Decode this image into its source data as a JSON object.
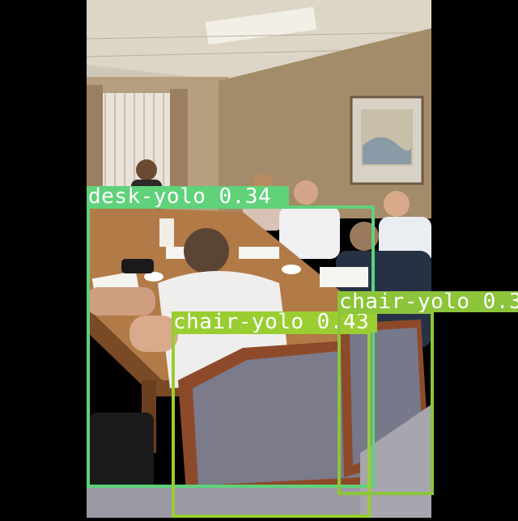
{
  "image": {
    "letterbox_color": "#000000",
    "scene": "conference room meeting around a wooden table"
  },
  "detections": [
    {
      "label": "desk-yolo 0.34",
      "class": "desk-yolo",
      "confidence": 0.34,
      "color": "#5fd27a"
    },
    {
      "label": "chair-yolo 0.43",
      "class": "chair-yolo",
      "confidence": 0.43,
      "color": "#9acd32"
    },
    {
      "label": "chair-yolo 0.3",
      "class": "chair-yolo",
      "confidence": 0.3,
      "color": "#8cc43a"
    }
  ]
}
